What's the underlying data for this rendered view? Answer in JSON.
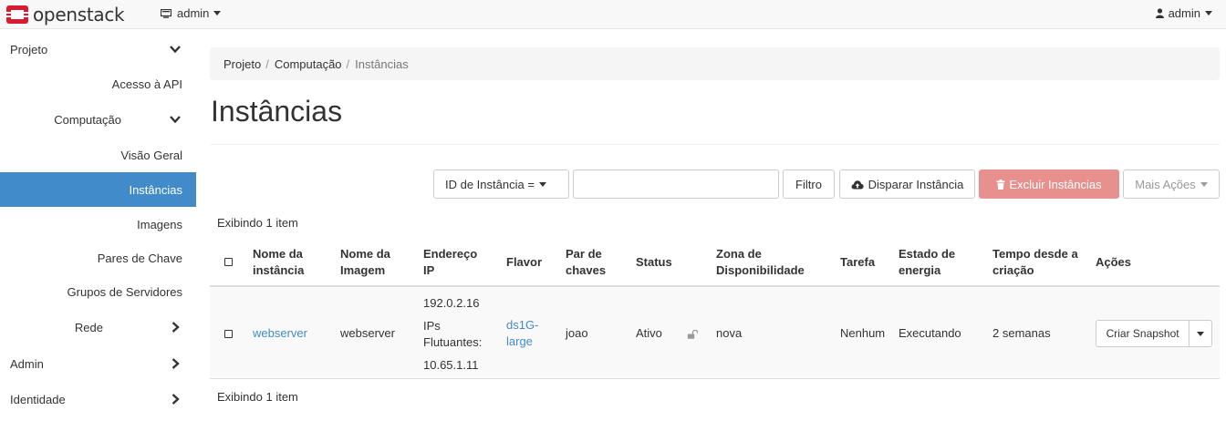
{
  "brand": {
    "name": "openstack",
    "colors": {
      "logo": "#da1a32"
    }
  },
  "topbar": {
    "project_label": "admin",
    "project_icon": "monitor-icon",
    "user_label": "admin",
    "user_icon": "user-icon"
  },
  "sidebar": {
    "items": [
      {
        "label": "Projeto",
        "chevron": "down"
      },
      {
        "label": "Acesso à API"
      },
      {
        "label": "Computação",
        "chevron": "down"
      },
      {
        "label": "Visão Geral"
      },
      {
        "label": "Instâncias",
        "active": true
      },
      {
        "label": "Imagens"
      },
      {
        "label": "Pares de Chave"
      },
      {
        "label": "Grupos de Servidores"
      },
      {
        "label": "Rede",
        "chevron": "right"
      },
      {
        "label": "Admin",
        "chevron": "right"
      },
      {
        "label": "Identidade",
        "chevron": "right"
      }
    ]
  },
  "breadcrumb": {
    "items": [
      "Projeto",
      "Computação",
      "Instâncias"
    ],
    "separator": "/"
  },
  "page": {
    "title": "Instâncias"
  },
  "toolbar": {
    "filter_select": "ID de Instância =",
    "filter_value": "",
    "filter_button": "Filtro",
    "launch_button": "Disparar Instância",
    "delete_button": "Excluir Instâncias",
    "more_button": "Mais Ações"
  },
  "table": {
    "count_text": "Exibindo 1 item",
    "headers": {
      "name": [
        "Nome da",
        "instância"
      ],
      "image": [
        "Nome da",
        "Imagem"
      ],
      "ip": [
        "Endereço",
        "IP"
      ],
      "flavor": "Flavor",
      "keypair": [
        "Par de",
        "chaves"
      ],
      "status": "Status",
      "az": [
        "Zona de",
        "Disponibilidade"
      ],
      "task": "Tarefa",
      "power": [
        "Estado de",
        "energia"
      ],
      "age": [
        "Tempo desde a",
        "criação"
      ],
      "actions": "Ações"
    },
    "rows": [
      {
        "name": "webserver",
        "image": "webserver",
        "ip_fixed": "192.0.2.16",
        "ip_floating_label": [
          "IPs",
          "Flutuantes:"
        ],
        "ip_floating": "10.65.1.11",
        "flavor": [
          "ds1G-",
          "large"
        ],
        "keypair": "joao",
        "status": "Ativo",
        "status_icon": "unlock-icon",
        "az": "nova",
        "task": "Nenhum",
        "power": "Executando",
        "age": "2 semanas",
        "action": "Criar Snapshot"
      }
    ]
  },
  "colors": {
    "active": "#428bca",
    "link": "#428bca",
    "danger": "#e8908e"
  }
}
